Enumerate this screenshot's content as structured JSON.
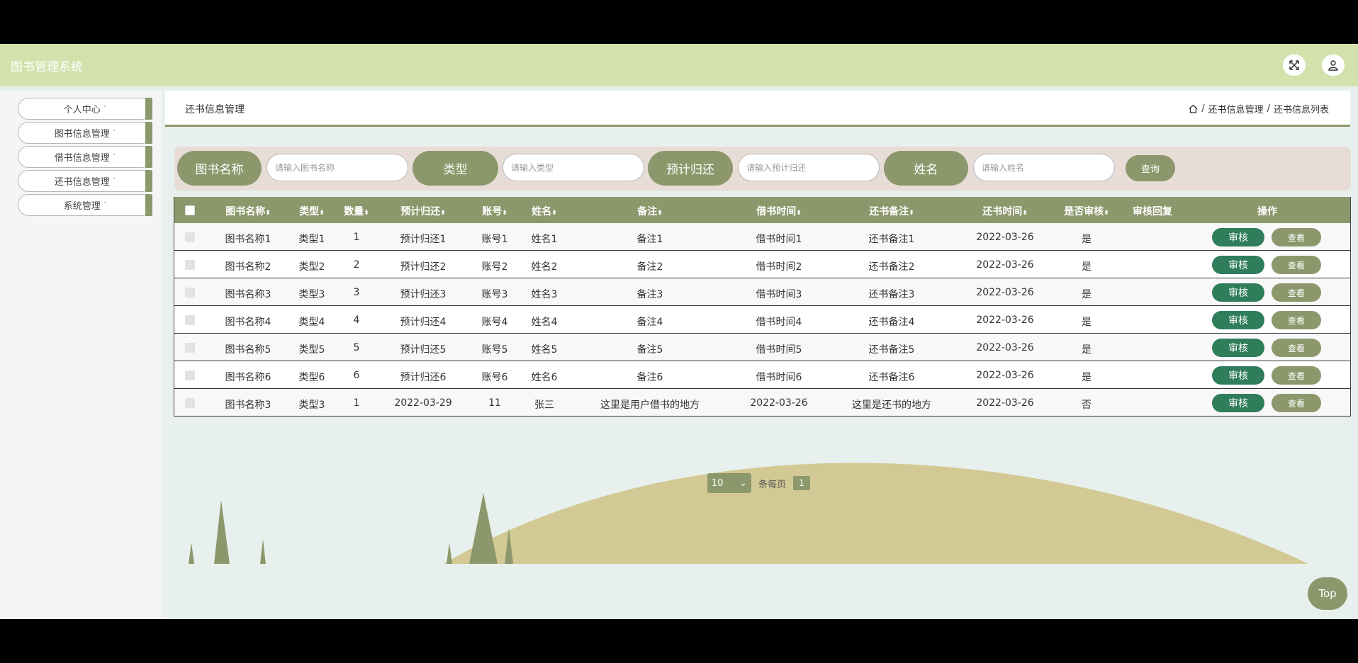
{
  "header": {
    "title": "图书管理系统"
  },
  "sidebar": {
    "items": [
      {
        "label": "个人中心"
      },
      {
        "label": "图书信息管理"
      },
      {
        "label": "借书信息管理"
      },
      {
        "label": "还书信息管理"
      },
      {
        "label": "系统管理"
      }
    ],
    "caret": "˅"
  },
  "page": {
    "title": "还书信息管理",
    "breadcrumb": [
      "还书信息管理",
      "还书信息列表"
    ],
    "separator": "/"
  },
  "search": {
    "fields": [
      {
        "label": "图书名称",
        "placeholder": "请输入图书名称"
      },
      {
        "label": "类型",
        "placeholder": "请输入类型"
      },
      {
        "label": "预计归还",
        "placeholder": "请输入预计归还"
      },
      {
        "label": "姓名",
        "placeholder": "请输入姓名"
      }
    ],
    "query_label": "查询"
  },
  "table": {
    "columns": [
      "图书名称",
      "类型",
      "数量",
      "预计归还",
      "账号",
      "姓名",
      "备注",
      "借书时间",
      "还书备注",
      "还书时间",
      "是否审核",
      "审核回复",
      "操作"
    ],
    "sort_glyph": "⬍",
    "review_label": "审核",
    "view_label": "查看",
    "rows": [
      [
        "图书名称1",
        "类型1",
        "1",
        "预计归还1",
        "账号1",
        "姓名1",
        "备注1",
        "借书时间1",
        "还书备注1",
        "2022-03-26",
        "是",
        ""
      ],
      [
        "图书名称2",
        "类型2",
        "2",
        "预计归还2",
        "账号2",
        "姓名2",
        "备注2",
        "借书时间2",
        "还书备注2",
        "2022-03-26",
        "是",
        ""
      ],
      [
        "图书名称3",
        "类型3",
        "3",
        "预计归还3",
        "账号3",
        "姓名3",
        "备注3",
        "借书时间3",
        "还书备注3",
        "2022-03-26",
        "是",
        ""
      ],
      [
        "图书名称4",
        "类型4",
        "4",
        "预计归还4",
        "账号4",
        "姓名4",
        "备注4",
        "借书时间4",
        "还书备注4",
        "2022-03-26",
        "是",
        ""
      ],
      [
        "图书名称5",
        "类型5",
        "5",
        "预计归还5",
        "账号5",
        "姓名5",
        "备注5",
        "借书时间5",
        "还书备注5",
        "2022-03-26",
        "是",
        ""
      ],
      [
        "图书名称6",
        "类型6",
        "6",
        "预计归还6",
        "账号6",
        "姓名6",
        "备注6",
        "借书时间6",
        "还书备注6",
        "2022-03-26",
        "是",
        ""
      ],
      [
        "图书名称3",
        "类型3",
        "1",
        "2022-03-29",
        "11",
        "张三",
        "这里是用户借书的地方",
        "2022-03-26",
        "这里是还书的地方",
        "2022-03-26",
        "否",
        ""
      ]
    ]
  },
  "pagination": {
    "page_size": "10",
    "per_page_label": "条每页",
    "current_page": "1"
  },
  "top_button": {
    "label": "Top"
  },
  "colors": {
    "accent": "#8c986c",
    "header_bg": "#d3e1ad",
    "review_button": "#2f7d5b"
  }
}
